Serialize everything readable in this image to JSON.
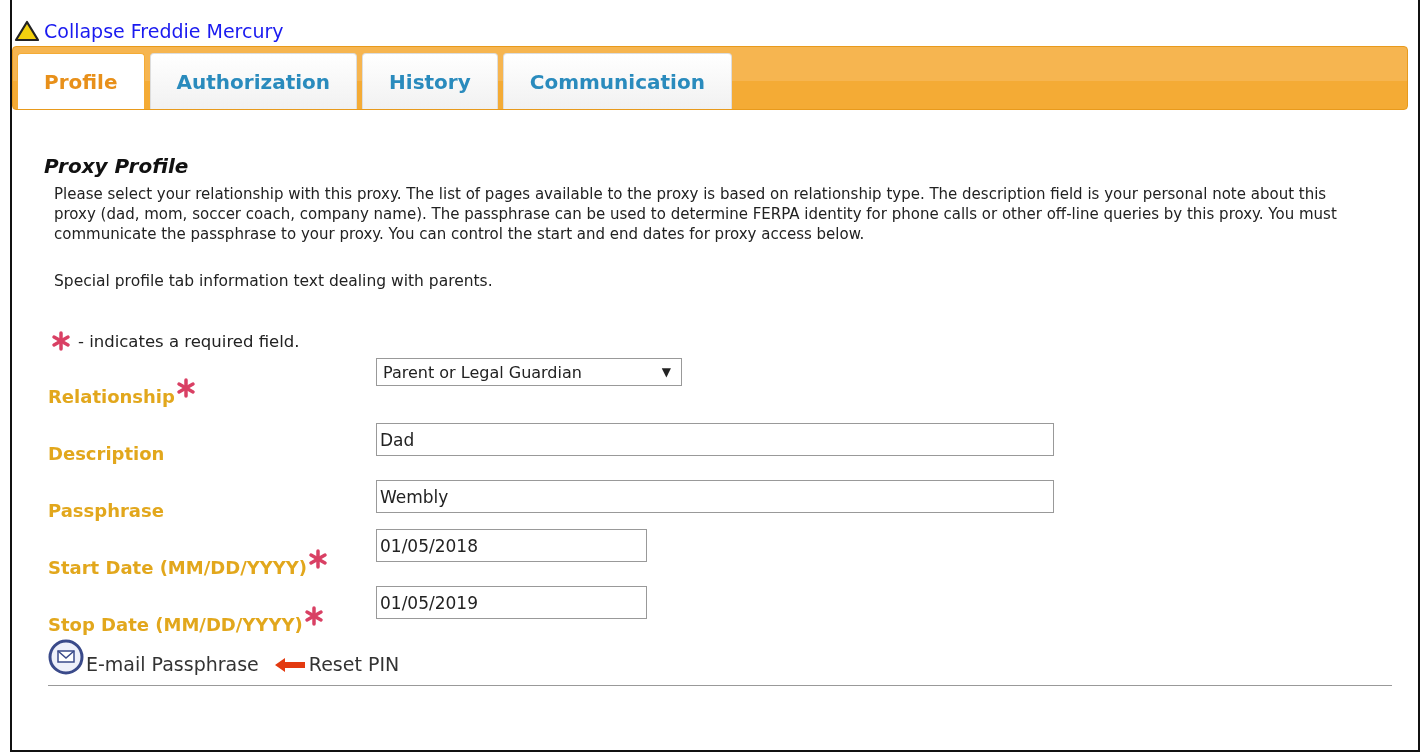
{
  "collapse_link": "Collapse Freddie Mercury",
  "tabs": [
    {
      "label": "Profile",
      "selected": true
    },
    {
      "label": "Authorization",
      "selected": false
    },
    {
      "label": "History",
      "selected": false
    },
    {
      "label": "Communication",
      "selected": false
    }
  ],
  "section_title": "Proxy Profile",
  "intro": "Please select your relationship with this proxy. The list of pages available to the proxy is based on relationship type. The description field is your personal note about this proxy (dad, mom, soccer coach, company name). The passphrase can be used to determine FERPA identity for phone calls or other off-line queries by this proxy. You must communicate the passphrase to your proxy. You can control the start and end dates for proxy access below.",
  "special_note": "Special profile tab information text dealing with parents.",
  "required_note": "- indicates a required field.",
  "fields": [
    {
      "label": "Relationship",
      "kind": "select",
      "value": "Parent or Legal Guardian",
      "required": true,
      "arrow": "▼"
    },
    {
      "label": "Description",
      "kind": "text",
      "value": "Dad",
      "required": false
    },
    {
      "label": "Passphrase",
      "kind": "text",
      "value": "Wembly",
      "required": false
    },
    {
      "label": "Start Date (MM/DD/YYYY)",
      "kind": "date",
      "value": "01/05/2018",
      "required": true
    },
    {
      "label": "Stop Date (MM/DD/YYYY)",
      "kind": "date",
      "value": "01/05/2019",
      "required": true
    }
  ],
  "actions": [
    {
      "label": "E-mail Passphrase",
      "kind": "email"
    },
    {
      "label": "Reset PIN",
      "kind": "reset"
    }
  ]
}
